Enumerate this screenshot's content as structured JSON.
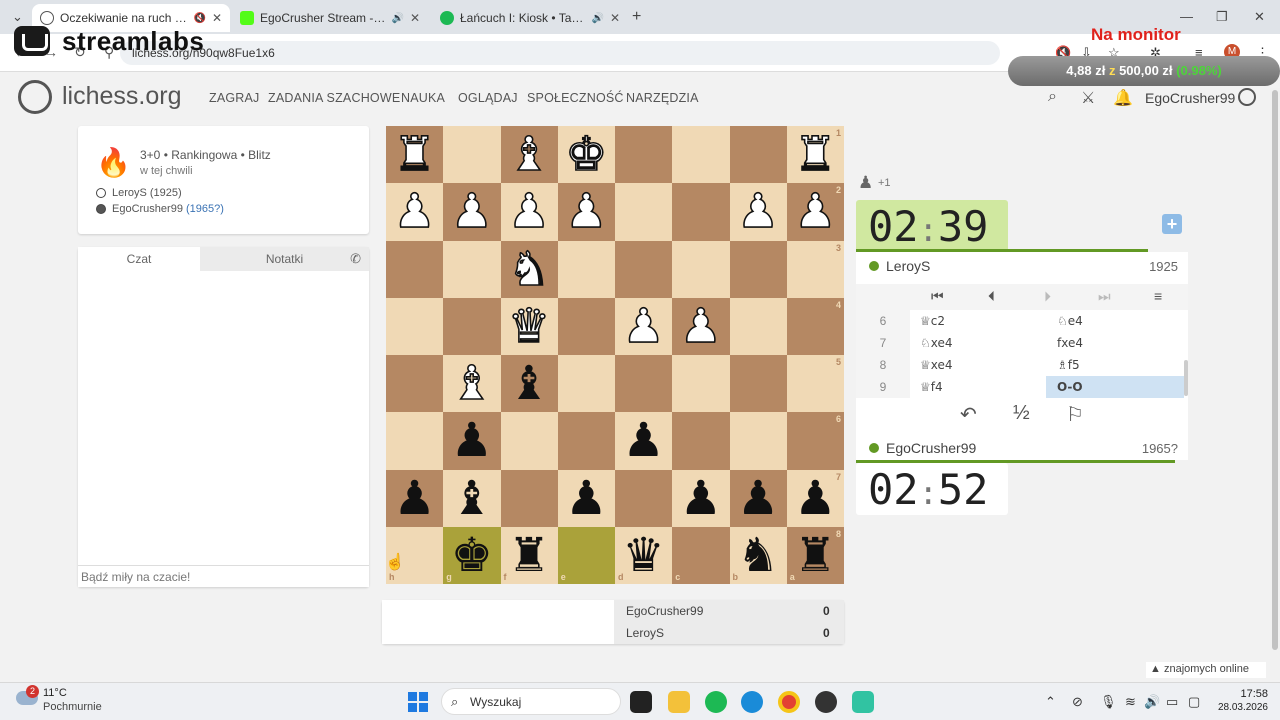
{
  "browser": {
    "tabs": [
      {
        "title": "Oczekiwanie na ruch przeci",
        "active": true,
        "icon": "lichess-icon",
        "color": "#ffffff"
      },
      {
        "title": "EgoCrusher Stream - Watch",
        "active": false,
        "icon": "kick-icon",
        "color": "#53fc18"
      },
      {
        "title": "Łańcuch I: Kiosk • Taco Hem",
        "active": false,
        "icon": "spotify-icon",
        "color": "#1db954"
      }
    ],
    "url": "lichess.org/n90qw8Fue1x6"
  },
  "overlay": {
    "brand": "streamlabs",
    "monitor_title": "Na monitor",
    "monitor_amount": "4,88 zł",
    "monitor_of": "z",
    "monitor_goal": "500,00 zł",
    "monitor_pct": "(0.98%)"
  },
  "header": {
    "logo": "lichess.org",
    "menu": [
      "ZAGRAJ",
      "ZADANIA SZACHOWE",
      "NAUKA",
      "OGLĄDAJ",
      "SPOŁECZNOŚĆ",
      "NARZĘDZIA"
    ],
    "user": "EgoCrusher99"
  },
  "game_info": {
    "type": "3+0 • Rankingowa • Blitz",
    "when": "w tej chwili",
    "white_name": "LeroyS",
    "white_rating": "(1925)",
    "black_name": "EgoCrusher99",
    "black_rating": "(1965?)"
  },
  "chat": {
    "tab_chat": "Czat",
    "tab_notes": "Notatki",
    "placeholder": "Bądź miły na czacie!"
  },
  "board": {
    "orientation": "black",
    "light": "#f0d9b5",
    "dark": "#b58863",
    "highlight": [
      "g8",
      "e8"
    ],
    "pieces": {
      "h1": "wR",
      "f1": "wB",
      "e1": "wK",
      "a1": "wR",
      "h2": "wP",
      "g2": "wP",
      "f2": "wP",
      "e2": "wP",
      "b2": "wP",
      "a2": "wP",
      "f3": "wN",
      "f4": "wQ",
      "d4": "wP",
      "c4": "wP",
      "g5": "wB",
      "f5": "bB",
      "g6": "bP",
      "d6": "bP",
      "h7": "bP",
      "g7": "bB",
      "e7": "bP",
      "c7": "bP",
      "b7": "bP",
      "a7": "bP",
      "g8": "bK",
      "f8": "bR",
      "d8": "bQ",
      "b8": "bN",
      "a8": "bR"
    },
    "ranks": [
      "1",
      "2",
      "3",
      "4",
      "5",
      "6",
      "7",
      "8"
    ],
    "files": [
      "h",
      "g",
      "f",
      "e",
      "d",
      "c",
      "b",
      "a"
    ]
  },
  "clocks": {
    "top_min": "02",
    "top_sec": "39",
    "bottom_min": "02",
    "bottom_sec": "52",
    "top_bar_fraction": 0.88,
    "bottom_bar_fraction": 0.96,
    "spectators": "+1"
  },
  "players": {
    "top_name": "LeroyS",
    "top_rating": "1925",
    "bottom_name": "EgoCrusher99",
    "bottom_rating": "1965?"
  },
  "moves": [
    {
      "n": "6",
      "w": "♕c2",
      "b": "♘e4"
    },
    {
      "n": "7",
      "w": "♘xe4",
      "b": "fxe4"
    },
    {
      "n": "8",
      "w": "♕xe4",
      "b": "♗f5"
    },
    {
      "n": "9",
      "w": "♕f4",
      "b": "O-O",
      "active": true
    }
  ],
  "actions": {
    "draw": "½"
  },
  "crosstable": [
    {
      "name": "EgoCrusher99",
      "score": "0"
    },
    {
      "name": "LeroyS",
      "score": "0"
    }
  ],
  "friends": "znajomych online",
  "taskbar": {
    "weather_temp": "11°C",
    "weather_desc": "Pochmurnie",
    "weather_badge": "2",
    "search": "Wyszukaj",
    "time": "17:58",
    "date": "28.03.2026"
  }
}
